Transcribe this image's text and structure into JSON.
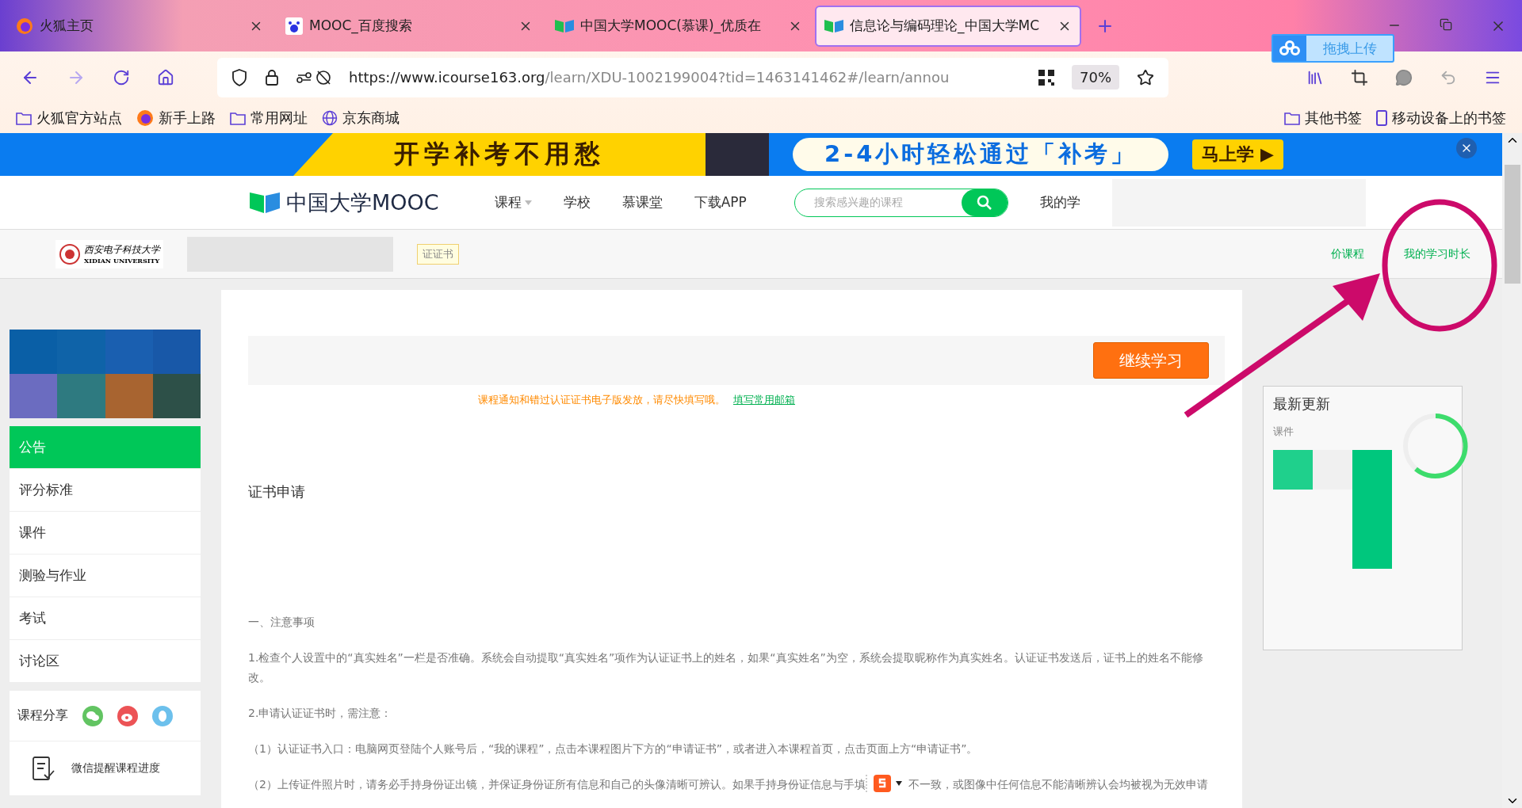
{
  "browser": {
    "tabs": [
      {
        "title": "火狐主页",
        "kind": "firefox",
        "selected": false
      },
      {
        "title": "MOOC_百度搜索",
        "kind": "baidu",
        "selected": false
      },
      {
        "title": "中国大学MOOC(慕课)_优质在",
        "kind": "mooc",
        "selected": false
      },
      {
        "title": "信息论与编码理论_中国大学MC",
        "kind": "mooc",
        "selected": true
      }
    ],
    "url_host": "https://www.icourse163.org",
    "url_path": "/learn/XDU-1002199004?tid=1463141462#/learn/annou",
    "zoom": "70%",
    "upload_widget": "拖拽上传",
    "bookmarks_left": [
      {
        "label": "火狐官方站点",
        "kind": "folder"
      },
      {
        "label": "新手上路",
        "kind": "firefox"
      },
      {
        "label": "常用网址",
        "kind": "folder"
      },
      {
        "label": "京东商城",
        "kind": "globe"
      }
    ],
    "bookmarks_right": [
      {
        "label": "其他书签",
        "kind": "folder"
      },
      {
        "label": "移动设备上的书签",
        "kind": "phone"
      }
    ]
  },
  "banner": {
    "headline": "开学补考不用愁",
    "offer": "2-4小时轻松通过「补考」",
    "cta": "马上学 ▶"
  },
  "header": {
    "logo": "中国大学MOOC",
    "nav": [
      {
        "label": "课程",
        "dropdown": true
      },
      {
        "label": "学校",
        "dropdown": false
      },
      {
        "label": "慕课堂",
        "dropdown": false
      },
      {
        "label": "下载APP",
        "dropdown": false
      }
    ],
    "search_placeholder": "搜索感兴趣的课程",
    "user_link": "我的学"
  },
  "course_bar": {
    "school": "西安电子科技大学",
    "school_en": "XIDIAN UNIVERSITY",
    "tag": "证证书",
    "links": [
      "价课程",
      "我的学习时长"
    ]
  },
  "sidebar": {
    "items": [
      {
        "label": "公告",
        "selected": true
      },
      {
        "label": "评分标准",
        "selected": false
      },
      {
        "label": "课件",
        "selected": false
      },
      {
        "label": "测验与作业",
        "selected": false
      },
      {
        "label": "考试",
        "selected": false
      },
      {
        "label": "讨论区",
        "selected": false
      }
    ],
    "share_label": "课程分享",
    "reminder": "微信提醒课程进度"
  },
  "main": {
    "continue_button": "继续学习",
    "notice": "课程通知和错过认证证书电子版发放，请尽快填写哦。",
    "notice_link": "填写常用邮箱",
    "section_title": "证书申请",
    "paragraphs": [
      "一、注意事项",
      "1.检查个人设置中的“真实姓名”一栏是否准确。系统会自动提取“真实姓名”项作为认证证书上的姓名，如果“真实姓名”为空，系统会提取昵称作为真实姓名。认证证书发送后，证书上的姓名不能修改。",
      "2.申请认证证书时，需注意：",
      "（1）认证证书入口：电脑网页登陆个人账号后，“我的课程”，点击本课程图片下方的“申请证书”，或者进入本课程首页，点击页面上方“申请证书”。"
    ],
    "last_paragraph_start": "（2）上传证件照片时，请务必手持身份证出镜，并保证身份证所有信息和自己的头像清晰可辨认。如果手持身份证信息与手填",
    "last_paragraph_end": "不一致，或图像中任何信息不能清晰辨认会均被视为",
    "last_paragraph_tail": "无效申请"
  },
  "updates": {
    "title": "最新更新",
    "label": "课件"
  }
}
